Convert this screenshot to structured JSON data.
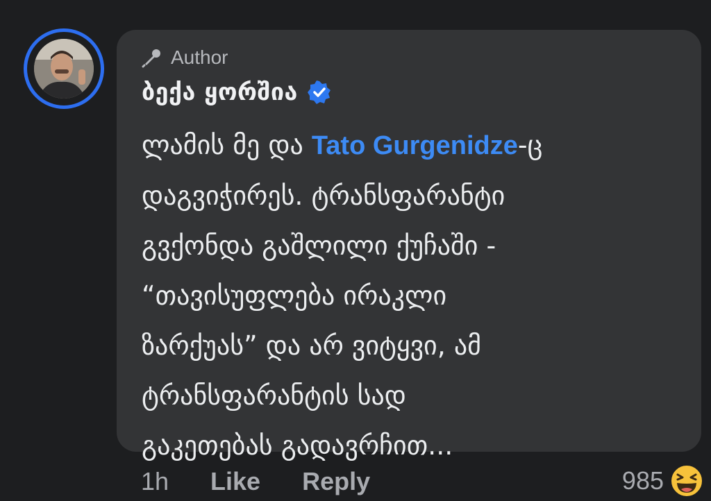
{
  "comment": {
    "author_badge": "Author",
    "user_name": "ბექა ყორშია",
    "verified": true,
    "body_lines": [
      {
        "before": "ლამის მე და ",
        "mention": "Tato Gurgenidze",
        "after": "-ც"
      },
      {
        "text": "დაგვიჭირეს. ტრანსფარანტი"
      },
      {
        "text": "გვქონდა გაშლილი ქუჩაში -"
      },
      {
        "text": "“თავისუფლება ირაკლი"
      },
      {
        "text": "ზარქუას” და არ ვიტყვი, ამ"
      },
      {
        "text": "ტრანსფარანტის სად"
      },
      {
        "text": "გაკეთებას გადავრჩით..."
      }
    ]
  },
  "actions": {
    "time": "1h",
    "like": "Like",
    "reply": "Reply"
  },
  "reactions": {
    "count": "985",
    "icon": "laughing-emoji-icon"
  },
  "colors": {
    "background": "#1d1e20",
    "bubble": "#333436",
    "accent": "#2d6ef0",
    "mention": "#3d8bf5"
  }
}
